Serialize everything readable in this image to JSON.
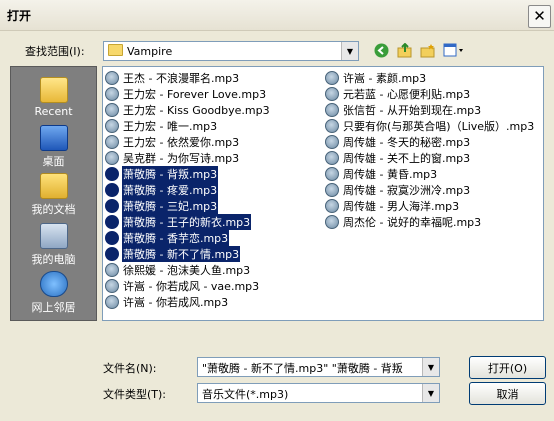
{
  "dialog": {
    "title": "打开",
    "close_glyph": "✕"
  },
  "lookin": {
    "label": "查找范围(I):",
    "value": "Vampire"
  },
  "places": [
    {
      "label": "Recent"
    },
    {
      "label": "桌面"
    },
    {
      "label": "我的文档"
    },
    {
      "label": "我的电脑"
    },
    {
      "label": "网上邻居"
    }
  ],
  "files_col1": [
    {
      "name": "王杰 - 不浪漫罪名.mp3",
      "selected": false
    },
    {
      "name": "王力宏 - Forever Love.mp3",
      "selected": false
    },
    {
      "name": "王力宏 - Kiss Goodbye.mp3",
      "selected": false
    },
    {
      "name": "王力宏 - 唯一.mp3",
      "selected": false
    },
    {
      "name": "王力宏 - 依然爱你.mp3",
      "selected": false
    },
    {
      "name": "吴克群 - 为你写诗.mp3",
      "selected": false
    },
    {
      "name": "萧敬腾 - 背叛.mp3",
      "selected": true
    },
    {
      "name": "萧敬腾 - 疼爱.mp3",
      "selected": true
    },
    {
      "name": "萧敬腾 - 三妃.mp3",
      "selected": true
    },
    {
      "name": "萧敬腾 - 王子的新衣.mp3",
      "selected": true
    },
    {
      "name": "萧敬腾 - 香芋恋.mp3",
      "selected": true
    },
    {
      "name": "萧敬腾 - 新不了情.mp3",
      "selected": true
    },
    {
      "name": "徐熙媛 - 泡沫美人鱼.mp3",
      "selected": false
    },
    {
      "name": "许嵩 - 你若成风 - vae.mp3",
      "selected": false
    },
    {
      "name": "许嵩 - 你若成风.mp3",
      "selected": false
    }
  ],
  "files_col2": [
    {
      "name": "许嵩 - 素颜.mp3",
      "selected": false
    },
    {
      "name": "元若蓝 - 心愿便利贴.mp3",
      "selected": false
    },
    {
      "name": "张信哲 - 从开始到现在.mp3",
      "selected": false
    },
    {
      "name": "只要有你(与那英合唱)（Live版）.mp3",
      "selected": false
    },
    {
      "name": "周传雄 - 冬天的秘密.mp3",
      "selected": false
    },
    {
      "name": "周传雄 - 关不上的窗.mp3",
      "selected": false
    },
    {
      "name": "周传雄 - 黄昏.mp3",
      "selected": false
    },
    {
      "name": "周传雄 - 寂寞沙洲冷.mp3",
      "selected": false
    },
    {
      "name": "周传雄 - 男人海洋.mp3",
      "selected": false
    },
    {
      "name": "周杰伦 - 说好的幸福呢.mp3",
      "selected": false
    }
  ],
  "filename": {
    "label": "文件名(N):",
    "value": "\"萧敬腾 - 新不了情.mp3\" \"萧敬腾 - 背叛"
  },
  "filetype": {
    "label": "文件类型(T):",
    "value": "音乐文件(*.mp3)"
  },
  "buttons": {
    "open": "打开(O)",
    "cancel": "取消"
  },
  "colors": {
    "selection": "#0a246a",
    "places_panel": "#7f7f7f",
    "dialog_bg": "#ece9d8"
  },
  "icons": {
    "back": "back-arrow-icon",
    "up": "folder-up-icon",
    "new_folder": "new-folder-icon",
    "views": "view-menu-icon"
  }
}
